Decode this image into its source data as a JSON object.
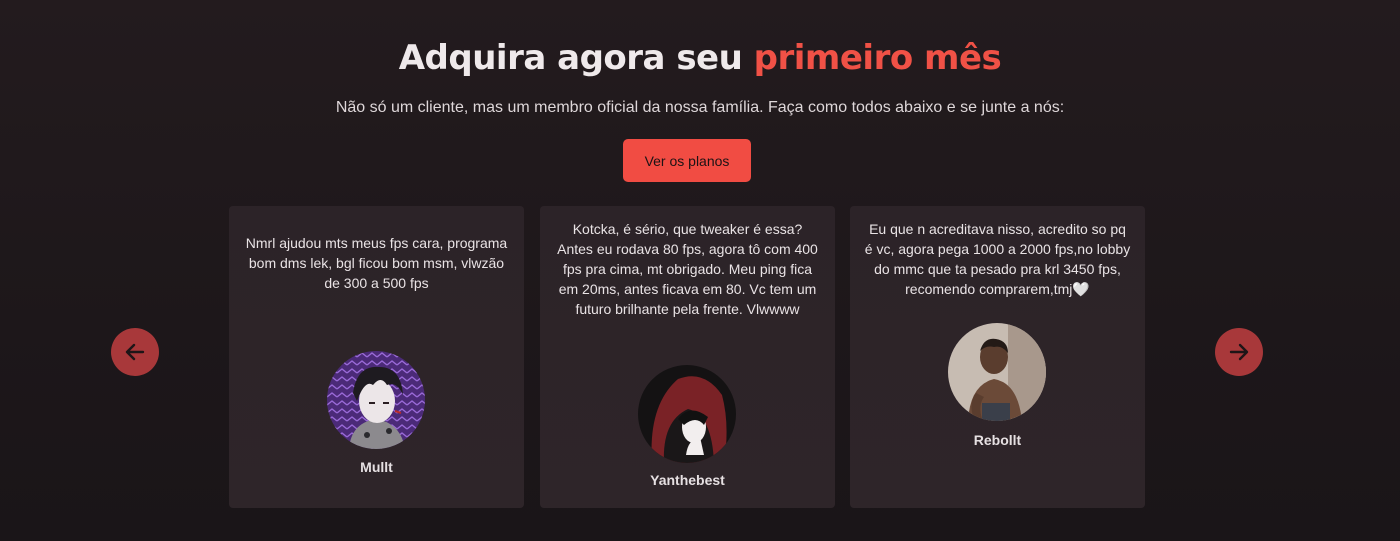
{
  "header": {
    "title_main": "Adquira agora seu ",
    "title_accent": "primeiro mês",
    "subtitle": "Não só um cliente, mas um membro oficial da nossa família. Faça como todos abaixo e se junte a nós:",
    "cta_label": "Ver os planos"
  },
  "colors": {
    "accent": "#f05146",
    "button": "#f14c43",
    "arrow": "#a8383a",
    "card": "#2c2328",
    "background": "#1f181b"
  },
  "carousel": {
    "prev_icon": "arrow-left-icon",
    "next_icon": "arrow-right-icon"
  },
  "testimonials": [
    {
      "quote": "Nmrl ajudou mts meus fps cara, programa bom dms lek, bgl ficou bom msm, vlwzão de 300 a 500 fps",
      "name": "Mullt",
      "avatar": "anime-avatar-purple"
    },
    {
      "quote": "Kotcka, é sério, que tweaker é essa? Antes eu rodava 80 fps, agora tô com 400 fps pra cima, mt obrigado. Meu ping fica em 20ms, antes ficava em 80. Vc tem um futuro brilhante pela frente. Vlwwww",
      "name": "Yanthebest",
      "avatar": "anime-avatar-red-hood"
    },
    {
      "quote": "Eu que n acreditava nisso, acredito so pq é vc, agora pega 1000 a 2000 fps,no lobby do mmc que ta pesado pra krl 3450 fps, recomendo comprarem,tmj🤍",
      "name": "Rebollt",
      "avatar": "photo-avatar-person"
    }
  ]
}
